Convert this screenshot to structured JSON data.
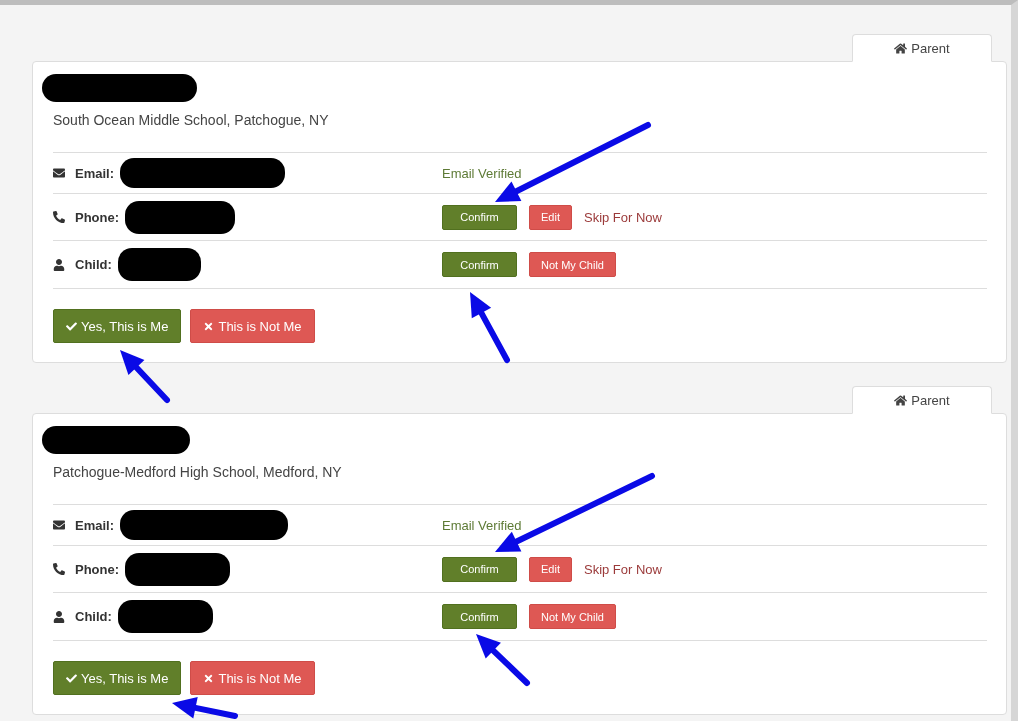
{
  "profiles": [
    {
      "tab": {
        "label": "Parent",
        "selected": true
      },
      "school": "South Ocean Middle School, Patchogue, NY",
      "rows": [
        {
          "kind": "email",
          "label": "Email:",
          "status": "Email Verified"
        },
        {
          "kind": "phone",
          "label": "Phone:",
          "actions": [
            {
              "kind": "confirm",
              "label": "Confirm"
            },
            {
              "kind": "danger",
              "label": "Edit"
            },
            {
              "kind": "link",
              "label": "Skip For Now"
            }
          ]
        },
        {
          "kind": "child",
          "label": "Child:",
          "actions": [
            {
              "kind": "confirm",
              "label": "Confirm"
            },
            {
              "kind": "danger",
              "label": "Not My Child"
            }
          ]
        }
      ],
      "buttons": [
        {
          "kind": "confirm",
          "label": "Yes, This is Me"
        },
        {
          "kind": "danger",
          "label": "This is Not Me"
        }
      ]
    },
    {
      "tab": {
        "label": "Parent",
        "selected": true
      },
      "school": "Patchogue-Medford High School, Medford, NY",
      "rows": [
        {
          "kind": "email",
          "label": "Email:",
          "status": "Email Verified"
        },
        {
          "kind": "phone",
          "label": "Phone:",
          "actions": [
            {
              "kind": "confirm",
              "label": "Confirm"
            },
            {
              "kind": "danger",
              "label": "Edit"
            },
            {
              "kind": "link",
              "label": "Skip For Now"
            }
          ]
        },
        {
          "kind": "child",
          "label": "Child:",
          "actions": [
            {
              "kind": "confirm",
              "label": "Confirm"
            },
            {
              "kind": "danger",
              "label": "Not My Child"
            }
          ]
        }
      ],
      "buttons": [
        {
          "kind": "confirm",
          "label": "Yes, This is Me"
        },
        {
          "kind": "danger",
          "label": "This is Not Me"
        }
      ]
    }
  ]
}
